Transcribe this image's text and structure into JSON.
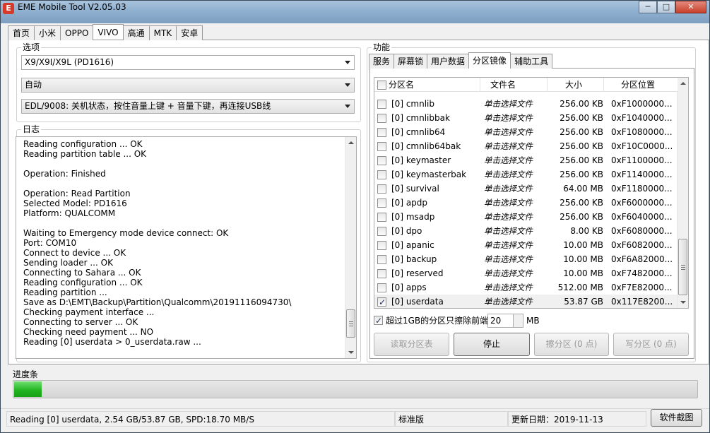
{
  "window": {
    "title": "EME Mobile Tool V2.05.03",
    "icon_letter": "E"
  },
  "brand_tabs": [
    {
      "label": "首页",
      "active": false
    },
    {
      "label": "小米",
      "active": false
    },
    {
      "label": "OPPO",
      "active": false
    },
    {
      "label": "VIVO",
      "active": true
    },
    {
      "label": "高通",
      "active": false
    },
    {
      "label": "MTK",
      "active": false
    },
    {
      "label": "安卓",
      "active": false
    }
  ],
  "options": {
    "group_label": "选项",
    "model": "X9/X9I/X9L (PD1616)",
    "mode": "自动",
    "method": "EDL/9008: 关机状态，按住音量上键 + 音量下键，再连接USB线"
  },
  "log": {
    "group_label": "日志",
    "lines": [
      "Reading configuration ... OK",
      "Reading partition table ... OK",
      "",
      "Operation: Finished",
      "",
      "Operation: Read Partition",
      "Selected Model:  PD1616",
      "Platform:  QUALCOMM",
      "",
      "Waiting to Emergency mode device connect: OK",
      "Port: COM10",
      "Connect to device ... OK",
      "Sending loader ... OK",
      "Connecting to Sahara ... OK",
      "Reading configuration ... OK",
      "Reading partition ...",
      "Save as D:\\EMT\\Backup\\Partition\\Qualcomm\\20191116094730\\",
      "Checking payment interface ...",
      "Connecting to server ... OK",
      "Checking need payment ... NO",
      "Reading [0] userdata > 0_userdata.raw ..."
    ]
  },
  "function": {
    "group_label": "功能",
    "tabs": [
      {
        "label": "服务",
        "active": false
      },
      {
        "label": "屏幕锁",
        "active": false
      },
      {
        "label": "用户数据",
        "active": false
      },
      {
        "label": "分区镜像",
        "active": true
      },
      {
        "label": "辅助工具",
        "active": false
      }
    ],
    "table": {
      "headers": [
        "分区名",
        "文件名",
        "大小",
        "分区位置"
      ],
      "rows": [
        {
          "name": "[0] cmnlib",
          "file": "单击选择文件",
          "size": "256.00 KB",
          "addr": "0xF1000000...",
          "checked": false
        },
        {
          "name": "[0] cmnlibbak",
          "file": "单击选择文件",
          "size": "256.00 KB",
          "addr": "0xF1040000...",
          "checked": false
        },
        {
          "name": "[0] cmnlib64",
          "file": "单击选择文件",
          "size": "256.00 KB",
          "addr": "0xF1080000...",
          "checked": false
        },
        {
          "name": "[0] cmnlib64bak",
          "file": "单击选择文件",
          "size": "256.00 KB",
          "addr": "0xF10C0000...",
          "checked": false
        },
        {
          "name": "[0] keymaster",
          "file": "单击选择文件",
          "size": "256.00 KB",
          "addr": "0xF1100000...",
          "checked": false
        },
        {
          "name": "[0] keymasterbak",
          "file": "单击选择文件",
          "size": "256.00 KB",
          "addr": "0xF1140000...",
          "checked": false
        },
        {
          "name": "[0] survival",
          "file": "单击选择文件",
          "size": "64.00 MB",
          "addr": "0xF1180000...",
          "checked": false
        },
        {
          "name": "[0] apdp",
          "file": "单击选择文件",
          "size": "256.00 KB",
          "addr": "0xF6000000...",
          "checked": false
        },
        {
          "name": "[0] msadp",
          "file": "单击选择文件",
          "size": "256.00 KB",
          "addr": "0xF6040000...",
          "checked": false
        },
        {
          "name": "[0] dpo",
          "file": "单击选择文件",
          "size": "8.00 KB",
          "addr": "0xF6080000...",
          "checked": false
        },
        {
          "name": "[0] apanic",
          "file": "单击选择文件",
          "size": "10.00 MB",
          "addr": "0xF6082000...",
          "checked": false
        },
        {
          "name": "[0] backup",
          "file": "单击选择文件",
          "size": "10.00 MB",
          "addr": "0xF6A82000...",
          "checked": false
        },
        {
          "name": "[0] reserved",
          "file": "单击选择文件",
          "size": "10.00 MB",
          "addr": "0xF7482000...",
          "checked": false
        },
        {
          "name": "[0] apps",
          "file": "单击选择文件",
          "size": "512.00 MB",
          "addr": "0xF7E82000...",
          "checked": false
        },
        {
          "name": "[0] userdata",
          "file": "单击选择文件",
          "size": "53.87 GB",
          "addr": "0x117E8200...",
          "checked": true
        }
      ]
    },
    "erase_option": {
      "label": "超过1GB的分区只擦除前端",
      "value": "20",
      "unit": "MB",
      "checked": true
    },
    "buttons": {
      "read": "读取分区表",
      "stop": "停止",
      "erase": "擦分区 (0 点)",
      "write": "写分区 (0 点)"
    }
  },
  "progress": {
    "label": "进度条",
    "fraction": 0.04
  },
  "status": {
    "message": "Reading [0] userdata, 2.54 GB/53.87 GB, SPD:18.70 MB/S",
    "edition": "标准版",
    "update_date": "更新日期：2019-11-13",
    "screenshot_button": "软件截图"
  },
  "colors": {
    "progress_fill": "#1eb21e",
    "close_button": "#c7402c"
  }
}
